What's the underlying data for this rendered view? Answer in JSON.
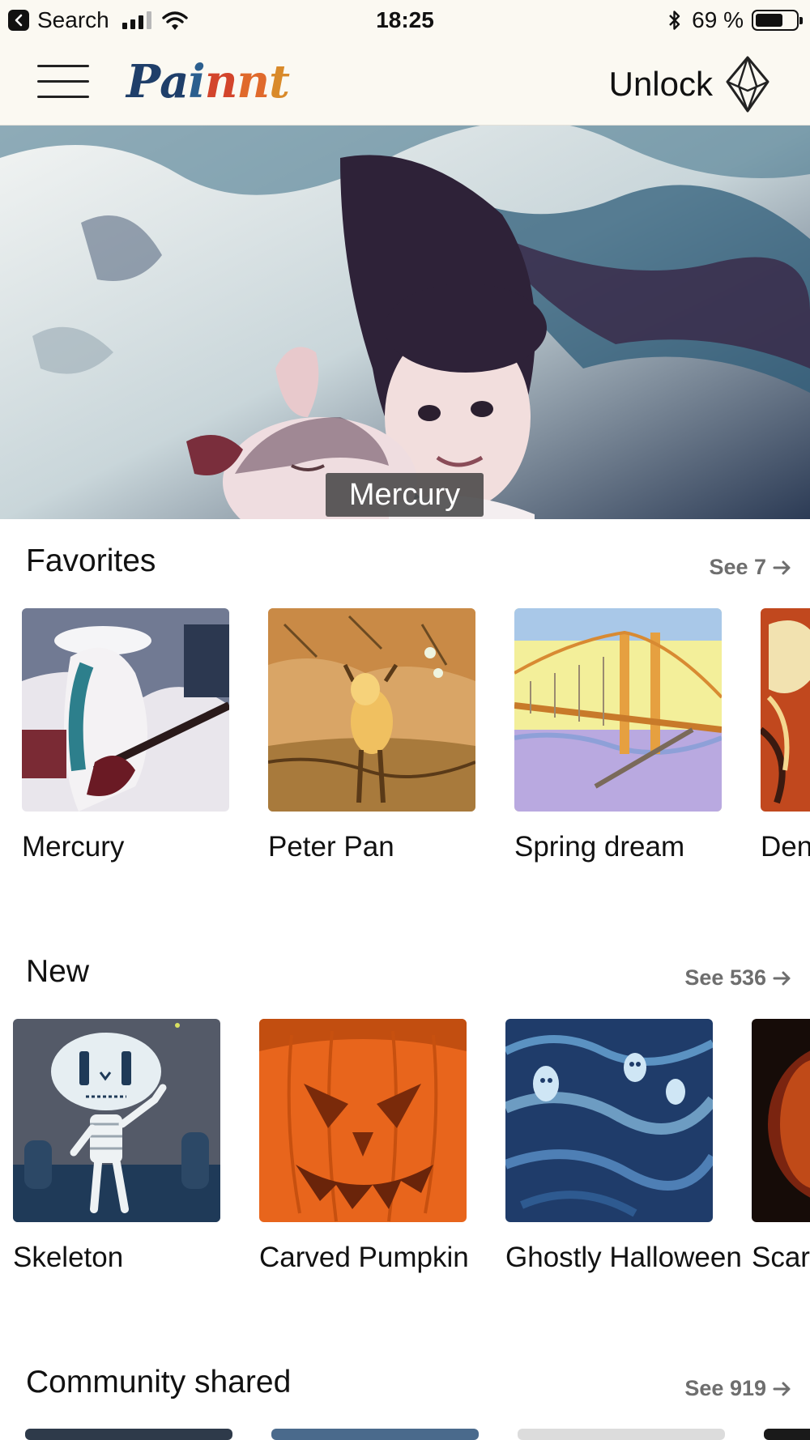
{
  "status_bar": {
    "back_app": "Search",
    "time": "18:25",
    "battery": "69 %",
    "battery_level": 0.69
  },
  "header": {
    "logo": "Painnt",
    "unlock_label": "Unlock",
    "logo_colors": [
      "#1f3f6a",
      "#1f3f6a",
      "#2b5f8f",
      "#d3452c",
      "#e06a2c",
      "#d98a2a"
    ]
  },
  "hero": {
    "caption": "Mercury"
  },
  "favorites": {
    "title": "Favorites",
    "see_all": "See 7",
    "items": [
      {
        "label": "Mercury"
      },
      {
        "label": "Peter Pan"
      },
      {
        "label": "Spring dream"
      },
      {
        "label": "Den"
      }
    ]
  },
  "new": {
    "title": "New",
    "see_all": "See 536",
    "items": [
      {
        "label": "Skeleton"
      },
      {
        "label": "Carved Pumpkin"
      },
      {
        "label": "Ghostly Halloween"
      },
      {
        "label": "Scar Hallo"
      }
    ]
  },
  "community": {
    "title": "Community shared",
    "see_all": "See 919"
  },
  "colors": {
    "header_bg": "#fbf9f2",
    "see_all_text": "#6e6e6e",
    "caption_bg": "#3c3c3c"
  }
}
